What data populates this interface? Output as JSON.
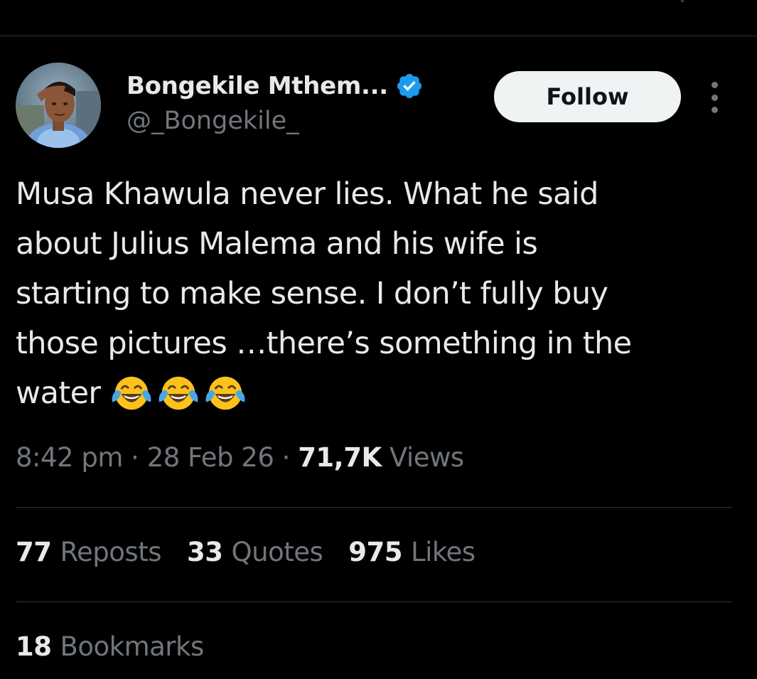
{
  "author": {
    "display_name": "Bongekile Mthem...",
    "handle": "@_Bongekile_",
    "verified": true,
    "verified_badge_color": "#1d9bf0",
    "avatar_icon": "profile-photo"
  },
  "header": {
    "follow_label": "Follow",
    "more_icon": "more-vertical-icon"
  },
  "tweet": {
    "text_lines": [
      "Musa Khawula never lies. What he said",
      "about Julius Malema and his wife is",
      "starting to make sense. I don’t fully buy",
      "those pictures …there’s something in the",
      "water"
    ],
    "emojis": [
      "face-with-tears-of-joy",
      "face-with-tears-of-joy",
      "face-with-tears-of-joy"
    ]
  },
  "meta": {
    "time": "8:42 pm",
    "separator": " · ",
    "date": "28 Feb 26",
    "views_count": "71,7K",
    "views_label": "Views"
  },
  "stats": {
    "reposts_count": "77",
    "reposts_label": "Reposts",
    "quotes_count": "33",
    "quotes_label": "Quotes",
    "likes_count": "975",
    "likes_label": "Likes",
    "bookmarks_count": "18",
    "bookmarks_label": "Bookmarks"
  },
  "colors": {
    "background": "#000000",
    "primary_text": "#e7e9ea",
    "secondary_text": "#71767b",
    "divider": "#2f3336",
    "follow_bg": "#eff3f4"
  }
}
